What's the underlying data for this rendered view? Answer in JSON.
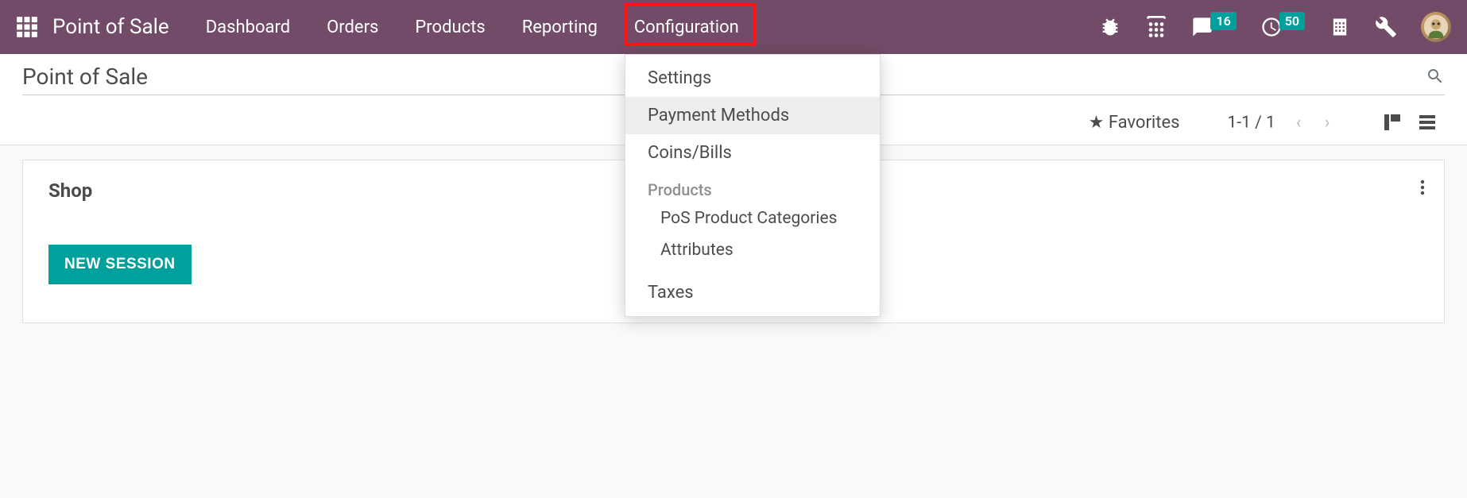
{
  "app_name": "Point of Sale",
  "nav": {
    "dashboard": "Dashboard",
    "orders": "Orders",
    "products": "Products",
    "reporting": "Reporting",
    "configuration": "Configuration"
  },
  "badges": {
    "messages": "16",
    "activities": "50"
  },
  "dropdown": {
    "settings": "Settings",
    "payment_methods": "Payment Methods",
    "coins_bills": "Coins/Bills",
    "products_header": "Products",
    "pos_product_categories": "PoS Product Categories",
    "attributes": "Attributes",
    "taxes": "Taxes"
  },
  "page": {
    "title": "Point of Sale",
    "favorites_label": "Favorites",
    "pager": "1-1 / 1"
  },
  "card": {
    "title": "Shop",
    "new_session_btn": "NEW SESSION"
  }
}
